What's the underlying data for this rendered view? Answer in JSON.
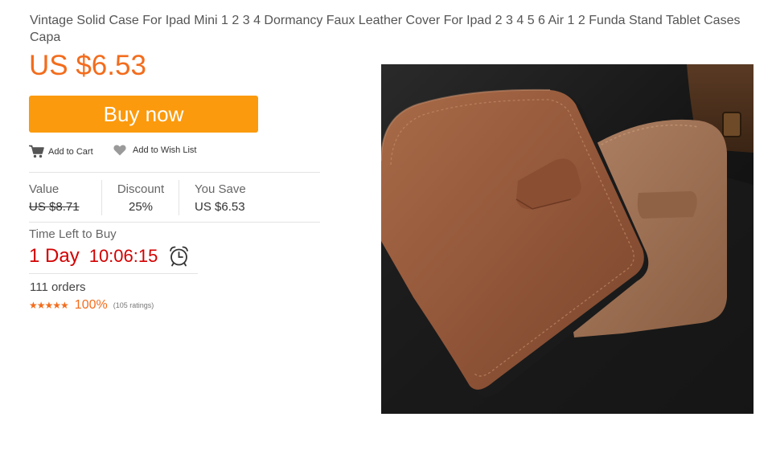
{
  "product": {
    "title": "Vintage Solid Case For Ipad Mini 1 2 3 4 Dormancy Faux Leather Cover For Ipad 2 3 4 5 6 Air 1 2 Funda Stand Tablet Cases Capa",
    "price": "US $6.53"
  },
  "actions": {
    "buy_now": "Buy now",
    "add_to_cart": "Add to Cart",
    "add_to_wish_list": "Add to Wish List"
  },
  "pricing": {
    "value_label": "Value",
    "value": "US $8.71",
    "discount_label": "Discount",
    "discount": "25%",
    "you_save_label": "You Save",
    "you_save": "US $6.53"
  },
  "timer": {
    "label": "Time Left to Buy",
    "days": "1 Day",
    "clock": "10:06:15"
  },
  "stats": {
    "orders": "111 orders",
    "rating_percent": "100%",
    "rating_count": "(105 ratings)",
    "stars": "★★★★★"
  },
  "icons": {
    "cart": "cart-icon",
    "wish": "heart-icon",
    "alarm": "alarm-clock-icon"
  },
  "colors": {
    "price_orange": "#f36c1c",
    "button_orange": "#fb9a0d",
    "timer_red": "#d30000"
  }
}
